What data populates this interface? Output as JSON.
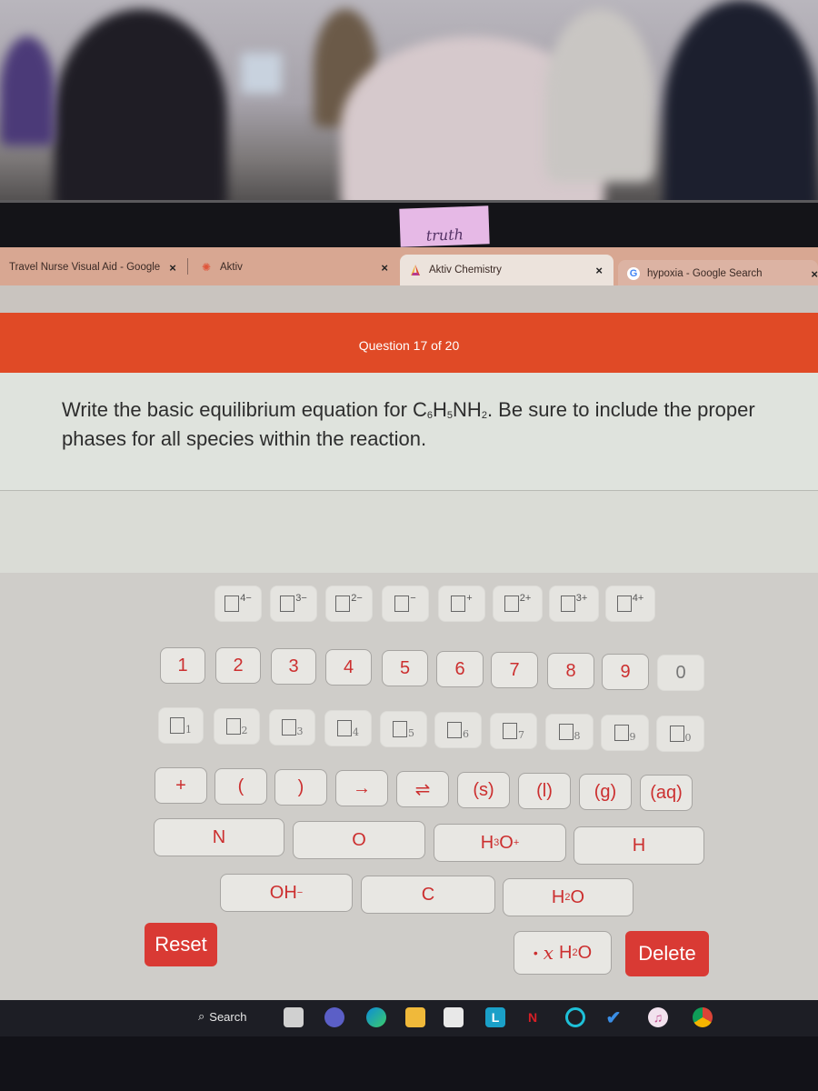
{
  "browser": {
    "tabs": [
      {
        "label": "Travel Nurse Visual Aid - Google",
        "icon": "google-docs-icon",
        "close": "×"
      },
      {
        "label": "Aktiv",
        "icon": "aktiv-icon",
        "close": "×"
      },
      {
        "label": "Aktiv Chemistry",
        "icon": "aktiv-chemistry-icon",
        "close": "×",
        "active": true
      },
      {
        "label": "hypoxia - Google Search",
        "icon": "google-icon",
        "close": "×"
      }
    ]
  },
  "sticker_text": "truth",
  "header": {
    "question_counter": "Question 17 of 20"
  },
  "question": {
    "text_before": "Write the basic equilibrium equation for ",
    "formula": {
      "c": "C",
      "c_sub": "6",
      "h": "H",
      "h_sub": "5",
      "nh": "NH",
      "nh_sub": "2"
    },
    "text_after": ". Be sure to include the proper phases for all species within the reaction."
  },
  "keypad": {
    "charges": [
      "4−",
      "3−",
      "2−",
      "−",
      "+",
      "2+",
      "3+",
      "4+"
    ],
    "digits": [
      "1",
      "2",
      "3",
      "4",
      "5",
      "6",
      "7",
      "8",
      "9",
      "0"
    ],
    "subscripts": [
      "1",
      "2",
      "3",
      "4",
      "5",
      "6",
      "7",
      "8",
      "9",
      "0"
    ],
    "symbols": [
      "+",
      "(",
      ")",
      "→",
      "⇌",
      "(s)",
      "(l)",
      "(g)",
      "(aq)"
    ],
    "species_row1": {
      "n": "N",
      "o": "O",
      "h3o": {
        "h": "H",
        "sub": "3",
        "o": "O",
        "sup": "+"
      },
      "h": "H"
    },
    "species_row2": {
      "oh": {
        "text": "OH",
        "sup": "−"
      },
      "c": "C",
      "h2o": {
        "h": "H",
        "sub": "2",
        "o": "O"
      }
    },
    "hydrate": {
      "dot": "•",
      "x": "x",
      "h": "H",
      "sub": "2",
      "o": "O"
    },
    "reset_label": "Reset",
    "delete_label": "Delete"
  },
  "taskbar": {
    "search_label": "Search",
    "apps": [
      "windows-start-icon",
      "task-view-icon",
      "teams-icon",
      "edge-icon",
      "file-explorer-icon",
      "store-icon",
      "l-app-icon",
      "netflix-icon",
      "alexa-icon",
      "todo-icon",
      "itunes-icon",
      "chrome-icon"
    ]
  },
  "colors": {
    "accent": "#e04a26",
    "key_text": "#cc2f2f",
    "button_red": "#d93a34"
  }
}
